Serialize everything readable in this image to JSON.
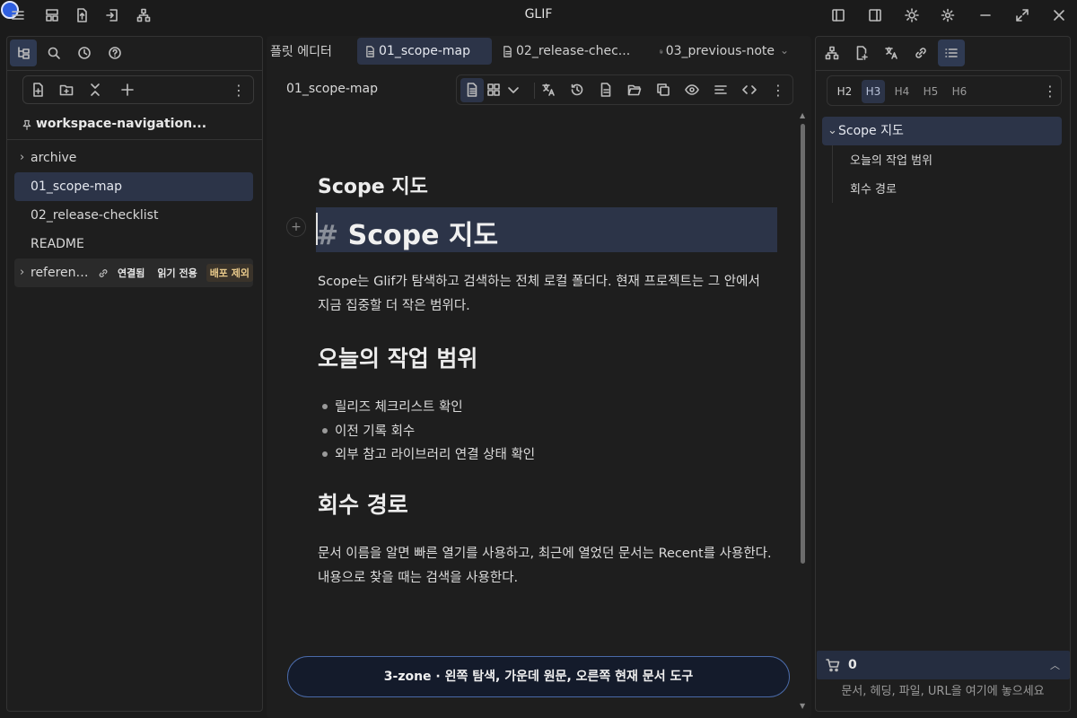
{
  "app": {
    "title": "GLIF"
  },
  "sidebar": {
    "workspace": "workspace-navigation...",
    "items": [
      {
        "label": "archive",
        "expandable": true
      },
      {
        "label": "01_scope-map",
        "selected": true
      },
      {
        "label": "02_release-checklist"
      },
      {
        "label": "README"
      },
      {
        "label": "reference...",
        "expandable": true,
        "badges": [
          "연결됨",
          "읽기 전용",
          "배포 제외"
        ]
      }
    ]
  },
  "tabs": [
    {
      "label": "플릿 에디터"
    },
    {
      "label": "01_scope-map",
      "active": true
    },
    {
      "label": "02_release-chec..."
    },
    {
      "label": "03_previous-note"
    }
  ],
  "editor": {
    "doc_name": "01_scope-map",
    "h2_preview": "Scope 지도",
    "h1_hash": "#",
    "h1_text": "Scope 지도",
    "intro": "Scope는 Glif가 탐색하고 검색하는 전체 로컬 폴더다. 현재 프로젝트는 그 안에서 지금 집중할 더 작은 범위다.",
    "section1": "오늘의 작업 범위",
    "bullets": [
      "릴리즈 체크리스트 확인",
      "이전 기록 회수",
      "외부 참고 라이브러리 연결 상태 확인"
    ],
    "section2": "회수 경로",
    "outro": "문서 이름을 알면 빠른 열기를 사용하고, 최근에 열었던 문서는 Recent를 사용한다. 내용으로 찾을 때는 검색을 사용한다.",
    "banner": "3-zone · 왼쪽 탐색, 가운데 원문, 오른쪽 현재 문서 도구"
  },
  "outline": {
    "heading_levels": [
      "H2",
      "H3",
      "H4",
      "H5",
      "H6"
    ],
    "active_level": "H3",
    "root": "Scope 지도",
    "items": [
      "오늘의 작업 범위",
      "회수 경로"
    ]
  },
  "drop_panel": {
    "count": "0",
    "hint": "문서, 헤딩, 파일, URL을 여기에 놓으세요"
  }
}
